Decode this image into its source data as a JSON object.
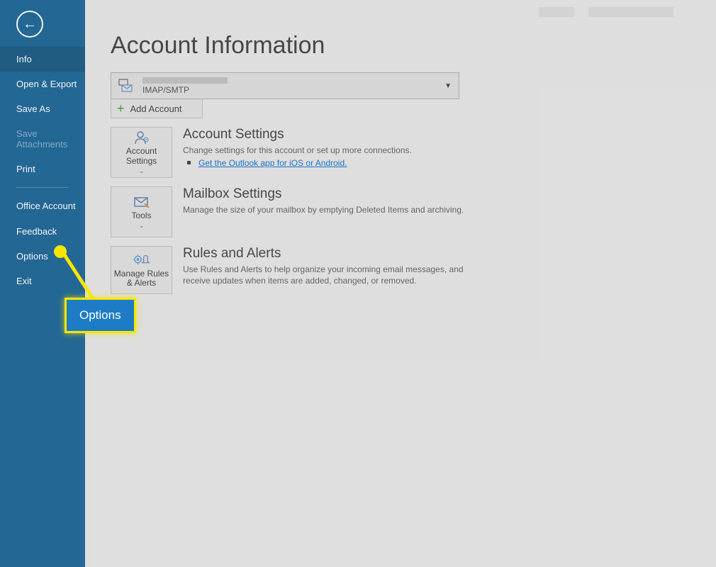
{
  "sidebar": {
    "items": [
      {
        "label": "Info",
        "state": "selected"
      },
      {
        "label": "Open & Export"
      },
      {
        "label": "Save As"
      },
      {
        "label": "Save Attachments",
        "state": "disabled"
      },
      {
        "label": "Print"
      },
      {
        "label": "Office Account",
        "sep_before": true
      },
      {
        "label": "Feedback"
      },
      {
        "label": "Options"
      },
      {
        "label": "Exit"
      }
    ]
  },
  "page": {
    "title": "Account Information"
  },
  "account": {
    "type": "IMAP/SMTP",
    "add_label": "Add Account"
  },
  "sections": [
    {
      "tile_label": "Account Settings",
      "has_caret": true,
      "title": "Account Settings",
      "desc": "Change settings for this account or set up more connections.",
      "link": "Get the Outlook app for iOS or Android."
    },
    {
      "tile_label": "Tools",
      "has_caret": true,
      "title": "Mailbox Settings",
      "desc": "Manage the size of your mailbox by emptying Deleted Items and archiving."
    },
    {
      "tile_label": "Manage Rules & Alerts",
      "has_caret": false,
      "title": "Rules and Alerts",
      "desc": "Use Rules and Alerts to help organize your incoming email messages, and receive updates when items are added, changed, or removed."
    }
  ],
  "callout": {
    "label": "Options"
  }
}
